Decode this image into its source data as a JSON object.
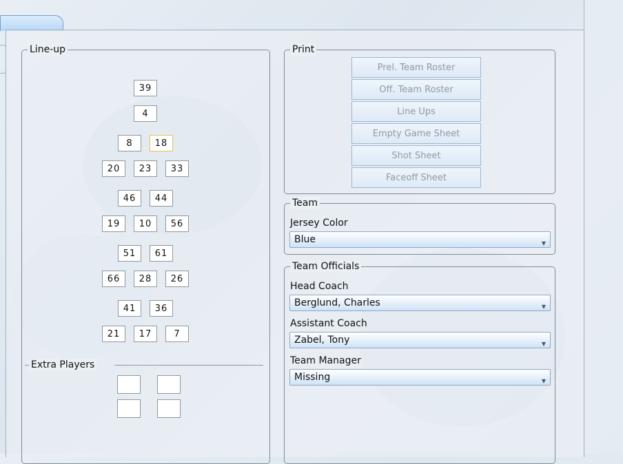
{
  "lineup": {
    "title": "Line-up",
    "rows": [
      [
        "39"
      ],
      [
        "4"
      ],
      [
        "8",
        "18"
      ],
      [
        "20",
        "23",
        "33"
      ],
      [
        "46",
        "44"
      ],
      [
        "19",
        "10",
        "56"
      ],
      [
        "51",
        "61"
      ],
      [
        "66",
        "28",
        "26"
      ],
      [
        "41",
        "36"
      ],
      [
        "21",
        "17",
        "7"
      ]
    ],
    "extra_players_label": "Extra Players"
  },
  "print": {
    "title": "Print",
    "buttons": [
      "Prel. Team Roster",
      "Off. Team Roster",
      "Line Ups",
      "Empty Game Sheet",
      "Shot Sheet",
      "Faceoff Sheet"
    ]
  },
  "team": {
    "title": "Team",
    "jersey_color_label": "Jersey Color",
    "jersey_color_value": "Blue"
  },
  "officials": {
    "title": "Team Officials",
    "head_coach_label": "Head Coach",
    "head_coach_value": "Berglund, Charles",
    "assistant_coach_label": "Assistant Coach",
    "assistant_coach_value": "Zabel, Tony",
    "team_manager_label": "Team Manager",
    "team_manager_value": "Missing"
  },
  "colors": {
    "selected_border": "#e6c64a",
    "combo_border": "#8ea7c2",
    "group_border": "#7f8b97"
  }
}
